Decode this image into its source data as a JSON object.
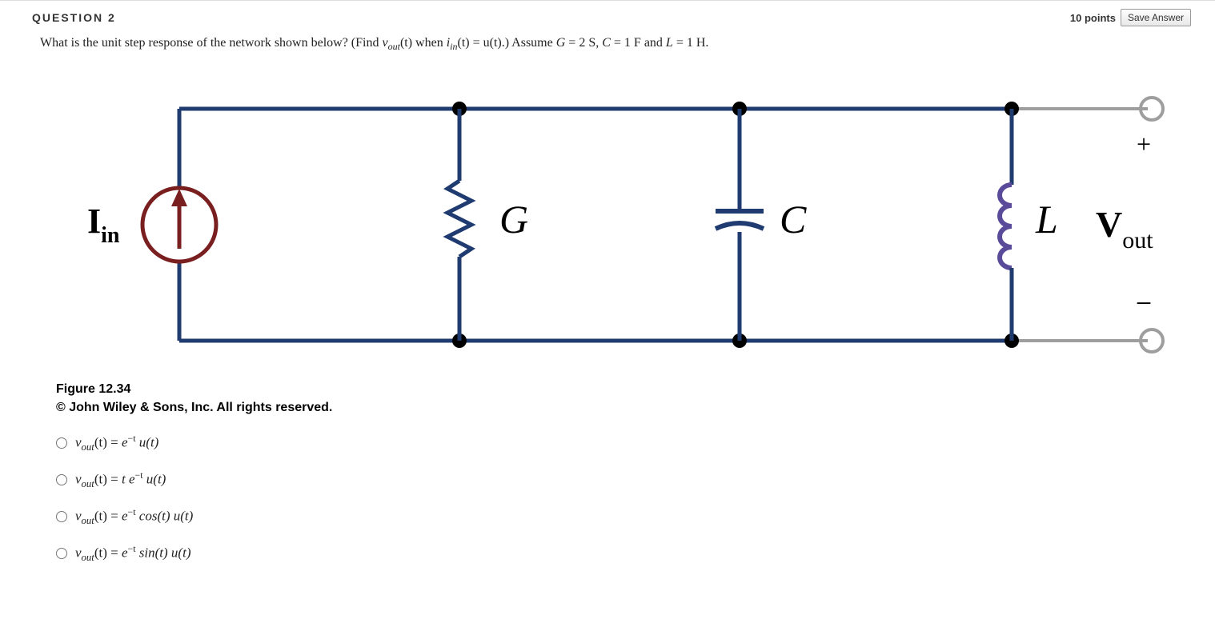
{
  "question": {
    "number_label": "QUESTION 2",
    "points": "10 points",
    "save_label": "Save Answer",
    "prompt_part1": "What is the unit step response of the network shown below?  (Find ",
    "prompt_vout": "v",
    "prompt_out_sub": "out",
    "prompt_part2_mid": "(t) when ",
    "prompt_iin": "i",
    "prompt_in_sub": "in",
    "prompt_part3_mid": "(t) = u(t).)  Assume ",
    "prompt_G": "G",
    "prompt_eq1": " = 2 S, ",
    "prompt_C": "C",
    "prompt_eq2": " = 1 F and ",
    "prompt_L": "L",
    "prompt_eq3": " = 1 H."
  },
  "circuit": {
    "labels": {
      "iin": "I",
      "iin_sub": "in",
      "G": "G",
      "C": "C",
      "L": "L",
      "V": "V",
      "out_sub": "out",
      "plus": "+",
      "minus": "−"
    }
  },
  "figure": {
    "number": "Figure 12.34",
    "copyright": "© John Wiley & Sons, Inc. All rights reserved."
  },
  "answers": {
    "a1_v": "v",
    "a1_out": "out",
    "a1_lhs_open": "(t) = ",
    "a1_e": "e",
    "a1_exp": "−t",
    "a1_tail": " u(t)",
    "a2_v": "v",
    "a2_out": "out",
    "a2_lhs_open": "(t) = ",
    "a2_t": "t ",
    "a2_e": "e",
    "a2_exp": "−t",
    "a2_tail": " u(t)",
    "a3_v": "v",
    "a3_out": "out",
    "a3_lhs_open": "(t) = ",
    "a3_e": "e",
    "a3_exp": "−t",
    "a3_tail": " cos(t) u(t)",
    "a4_v": "v",
    "a4_out": "out",
    "a4_lhs_open": "(t) = ",
    "a4_e": "e",
    "a4_exp": "−t",
    "a4_tail": " sin(t) u(t)"
  }
}
